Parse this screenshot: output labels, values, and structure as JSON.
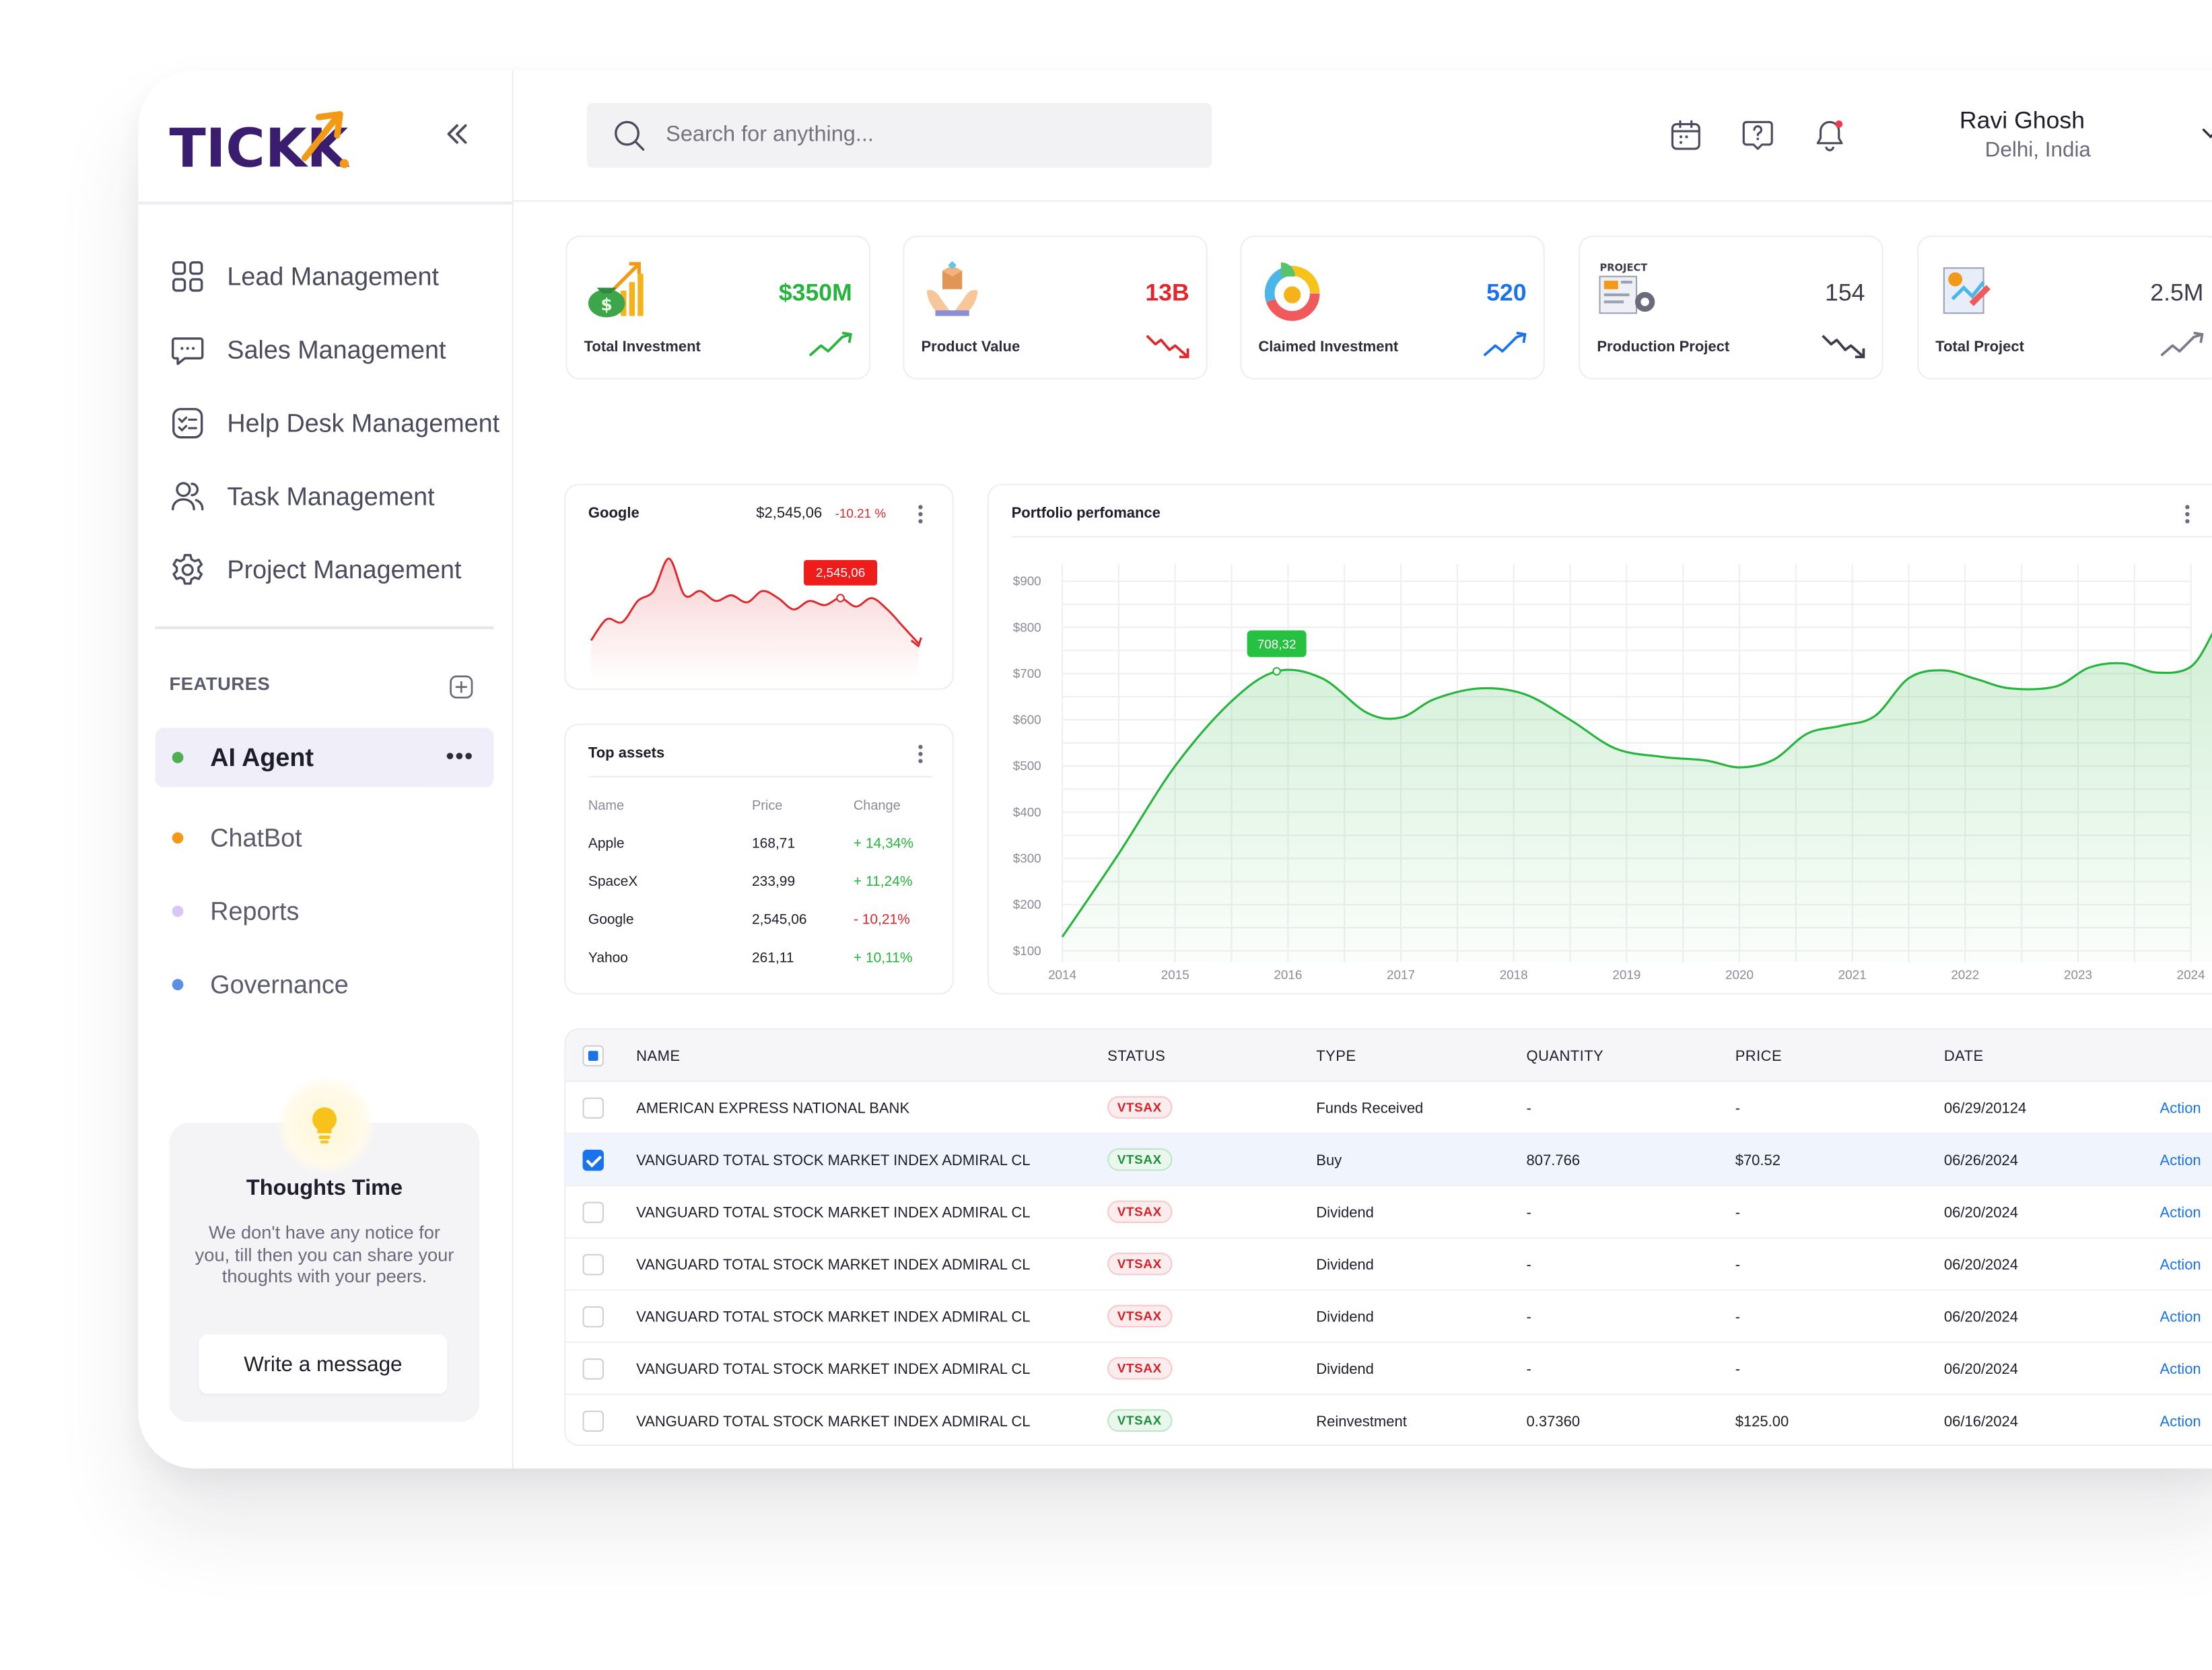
{
  "app": {
    "logo": "TICKK"
  },
  "sidebar": {
    "nav": [
      {
        "label": "Lead Management",
        "icon": "grid-icon"
      },
      {
        "label": "Sales Management",
        "icon": "chat-icon"
      },
      {
        "label": "Help Desk Management",
        "icon": "checklist-icon"
      },
      {
        "label": "Task Management",
        "icon": "users-icon"
      },
      {
        "label": "Project Management",
        "icon": "gear-icon"
      }
    ],
    "features_title": "FEATURES",
    "features": [
      {
        "label": "AI Agent",
        "dot": "#4caf50",
        "active": true,
        "more": "•••"
      },
      {
        "label": "ChatBot",
        "dot": "#f29a17",
        "active": false
      },
      {
        "label": "Reports",
        "dot": "#d9c6f2",
        "active": false
      },
      {
        "label": "Governance",
        "dot": "#5b8ee6",
        "active": false
      }
    ],
    "thoughts": {
      "title": "Thoughts Time",
      "text": "We don't have any notice for you, till then you can share your thoughts with your peers.",
      "button": "Write a message"
    }
  },
  "topbar": {
    "search_placeholder": "Search for anything...",
    "user": {
      "name": "Ravi Ghosh",
      "location": "Delhi, India"
    }
  },
  "stats": [
    {
      "value": "$350M",
      "label": "Total Investment",
      "color": "#27b43c",
      "trend": "up",
      "trend_color": "#27b43c"
    },
    {
      "value": "13B",
      "label": "Product Value",
      "color": "#e0282c",
      "trend": "down",
      "trend_color": "#e0282c"
    },
    {
      "value": "520",
      "label": "Claimed Investment",
      "color": "#1a73e8",
      "trend": "up",
      "trend_color": "#1a73e8"
    },
    {
      "value": "154",
      "label": "Production Project",
      "color": "#3c3c4c",
      "trend": "down",
      "trend_color": "#3c3c4c"
    },
    {
      "value": "2.5M",
      "label": "Total Project",
      "color": "#3c3c4c",
      "trend": "up",
      "trend_color": "#7a7a88"
    }
  ],
  "google_card": {
    "title": "Google",
    "price": "$2,545,06",
    "change": "-10.21 %",
    "tooltip": "2,545,06"
  },
  "top_assets": {
    "title": "Top assets",
    "headers": [
      "Name",
      "Price",
      "Change"
    ],
    "rows": [
      {
        "name": "Apple",
        "price": "168,71",
        "change": "+ 14,34%",
        "positive": true
      },
      {
        "name": "SpaceX",
        "price": "233,99",
        "change": "+ 11,24%",
        "positive": true
      },
      {
        "name": "Google",
        "price": "2,545,06",
        "change": "- 10,21%",
        "positive": false
      },
      {
        "name": "Yahoo",
        "price": "261,11",
        "change": "+ 10,11%",
        "positive": true
      }
    ]
  },
  "chart_data": [
    {
      "type": "area",
      "title": "Google",
      "color": "#e0282c",
      "y": [
        20,
        35,
        33,
        48,
        55,
        78,
        52,
        55,
        48,
        52,
        47,
        55,
        50,
        42,
        48,
        45,
        50,
        44,
        50,
        42,
        30,
        18
      ],
      "tooltip_index": 16,
      "tooltip_label": "2,545,06"
    },
    {
      "type": "area",
      "title": "Portfolio perfomance",
      "color": "#27b43c",
      "x": [
        2014,
        2015,
        2016,
        2017,
        2018,
        2019,
        2020,
        2021,
        2022,
        2023,
        2024
      ],
      "xlim": [
        2014,
        2024
      ],
      "ylim": [
        100,
        900
      ],
      "yticks": [
        "$100",
        "$200",
        "$300",
        "$400",
        "$500",
        "$600",
        "$700",
        "$800",
        "$900"
      ],
      "xticks": [
        "2014",
        "2015",
        "2016",
        "2017",
        "2018",
        "2019",
        "2020",
        "2021",
        "2022",
        "2023",
        "2024"
      ],
      "grid": true,
      "points": [
        [
          2014.0,
          130
        ],
        [
          2014.5,
          310
        ],
        [
          2015.0,
          500
        ],
        [
          2015.5,
          640
        ],
        [
          2015.9,
          705
        ],
        [
          2016.3,
          690
        ],
        [
          2016.7,
          615
        ],
        [
          2017.0,
          605
        ],
        [
          2017.3,
          645
        ],
        [
          2017.7,
          668
        ],
        [
          2018.1,
          655
        ],
        [
          2018.5,
          600
        ],
        [
          2018.9,
          538
        ],
        [
          2019.3,
          520
        ],
        [
          2019.7,
          512
        ],
        [
          2020.0,
          497
        ],
        [
          2020.3,
          513
        ],
        [
          2020.6,
          570
        ],
        [
          2020.9,
          587
        ],
        [
          2021.2,
          608
        ],
        [
          2021.5,
          690
        ],
        [
          2021.8,
          707
        ],
        [
          2022.1,
          688
        ],
        [
          2022.4,
          668
        ],
        [
          2022.8,
          672
        ],
        [
          2023.1,
          713
        ],
        [
          2023.4,
          722
        ],
        [
          2023.7,
          702
        ],
        [
          2024.0,
          715
        ],
        [
          2024.2,
          790
        ],
        [
          2024.3,
          835
        ]
      ],
      "tooltip_point": [
        2015.9,
        705
      ],
      "tooltip_label": "708,32"
    }
  ],
  "transactions": {
    "headers": [
      "NAME",
      "STATUS",
      "TYPE",
      "QUANTITY",
      "PRICE",
      "DATE"
    ],
    "rows": [
      {
        "name": "AMERICAN EXPRESS NATIONAL BANK",
        "status": "VTSAX",
        "status_tone": "red",
        "type": "Funds Received",
        "quantity": "-",
        "price": "-",
        "date": "06/29/20124",
        "action": "Action",
        "checked": false
      },
      {
        "name": "VANGUARD TOTAL STOCK MARKET INDEX ADMIRAL CL",
        "status": "VTSAX",
        "status_tone": "green",
        "type": "Buy",
        "quantity": "807.766",
        "price": "$70.52",
        "date": "06/26/2024",
        "action": "Action",
        "checked": true
      },
      {
        "name": "VANGUARD TOTAL STOCK MARKET INDEX ADMIRAL CL",
        "status": "VTSAX",
        "status_tone": "red",
        "type": "Dividend",
        "quantity": "-",
        "price": "-",
        "date": "06/20/2024",
        "action": "Action",
        "checked": false
      },
      {
        "name": "VANGUARD TOTAL STOCK MARKET INDEX ADMIRAL CL",
        "status": "VTSAX",
        "status_tone": "red",
        "type": "Dividend",
        "quantity": "-",
        "price": "-",
        "date": "06/20/2024",
        "action": "Action",
        "checked": false
      },
      {
        "name": "VANGUARD TOTAL STOCK MARKET INDEX ADMIRAL CL",
        "status": "VTSAX",
        "status_tone": "red",
        "type": "Dividend",
        "quantity": "-",
        "price": "-",
        "date": "06/20/2024",
        "action": "Action",
        "checked": false
      },
      {
        "name": "VANGUARD TOTAL STOCK MARKET INDEX ADMIRAL CL",
        "status": "VTSAX",
        "status_tone": "red",
        "type": "Dividend",
        "quantity": "-",
        "price": "-",
        "date": "06/20/2024",
        "action": "Action",
        "checked": false
      },
      {
        "name": "VANGUARD TOTAL STOCK MARKET INDEX ADMIRAL CL",
        "status": "VTSAX",
        "status_tone": "green",
        "type": "Reinvestment",
        "quantity": "0.37360",
        "price": "$125.00",
        "date": "06/16/2024",
        "action": "Action",
        "checked": false
      }
    ]
  }
}
